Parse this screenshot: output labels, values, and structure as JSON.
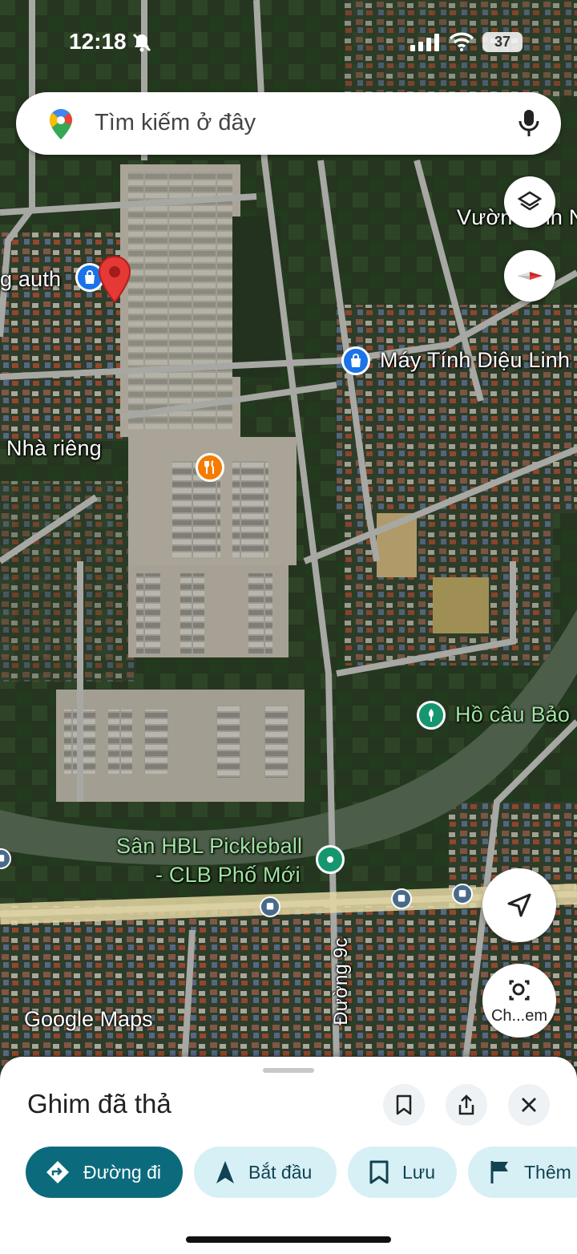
{
  "status_bar": {
    "time": "12:18",
    "battery": "37"
  },
  "search": {
    "placeholder": "Tìm kiếm ở đây"
  },
  "map": {
    "labels": {
      "auth": "g auth",
      "vuon": "Vườn Sinh N",
      "may_tinh": "Máy Tính Diệu Linh",
      "nha_rieng": "Nhà riêng",
      "ho_cau": "Hồ câu Bảo",
      "pickleball_1": "Sân HBL Pickleball",
      "pickleball_2": "- CLB Phố Mới",
      "duong": "Đường 9c"
    },
    "attribution": "Google Maps"
  },
  "controls": {
    "street_view_label": "Ch...em"
  },
  "sheet": {
    "title": "Ghim đã thả",
    "chips": {
      "directions": "Đường đi",
      "start": "Bắt đầu",
      "save": "Lưu",
      "more": "Thêm"
    }
  },
  "colors": {
    "accent": "#0b6b7d",
    "chip_bg": "#d6f0f5",
    "pin": "#e53935"
  }
}
